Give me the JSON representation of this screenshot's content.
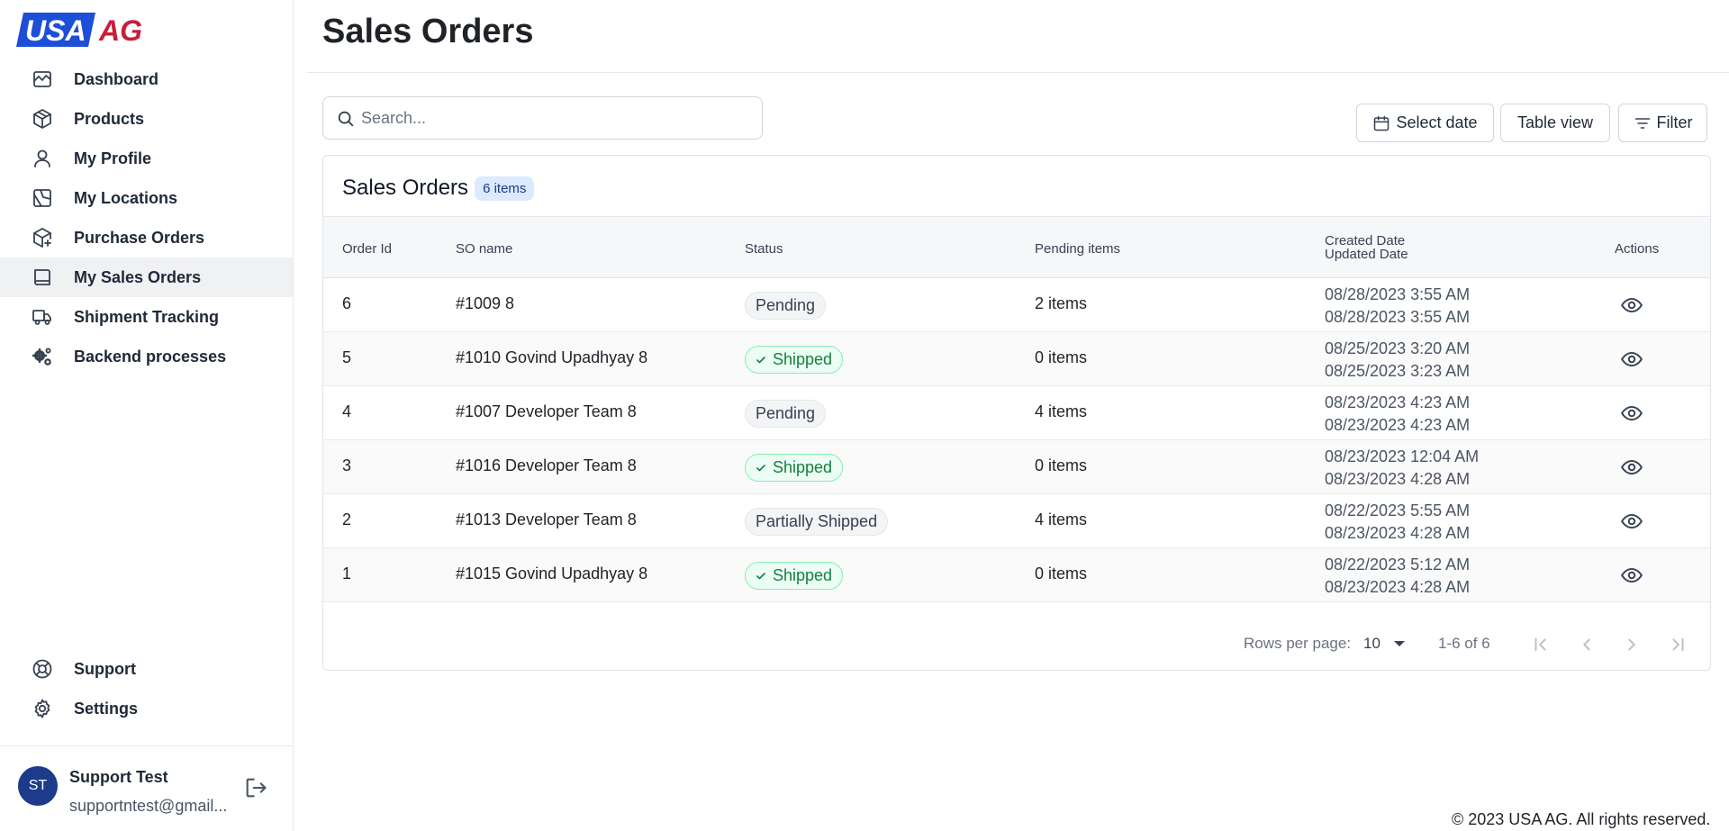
{
  "brand": {
    "logo_text_1": "USA",
    "logo_text_2": "AG",
    "blue": "#1d4ed8",
    "red": "#c81e3a"
  },
  "sidebar": {
    "items": [
      {
        "label": "Dashboard",
        "icon": "chart-icon"
      },
      {
        "label": "Products",
        "icon": "box-icon"
      },
      {
        "label": "My Profile",
        "icon": "user-icon"
      },
      {
        "label": "My Locations",
        "icon": "map-icon"
      },
      {
        "label": "Purchase Orders",
        "icon": "box-plus-icon"
      },
      {
        "label": "My Sales Orders",
        "icon": "book-icon",
        "active": true
      },
      {
        "label": "Shipment Tracking",
        "icon": "truck-icon"
      },
      {
        "label": "Backend processes",
        "icon": "gears-icon"
      }
    ],
    "bottom_items": [
      {
        "label": "Support",
        "icon": "lifebuoy-icon"
      },
      {
        "label": "Settings",
        "icon": "gear-icon"
      }
    ],
    "user": {
      "initials": "ST",
      "name": "Support Test",
      "email": "supportntest@gmail..."
    }
  },
  "header": {
    "title": "Sales Orders"
  },
  "toolbar": {
    "search_placeholder": "Search...",
    "select_date_label": "Select date",
    "table_view_label": "Table view",
    "filter_label": "Filter"
  },
  "table": {
    "title": "Sales Orders",
    "count_badge": "6 items",
    "columns": {
      "order_id": "Order Id",
      "so_name": "SO name",
      "status": "Status",
      "pending": "Pending items",
      "created": "Created Date",
      "updated": "Updated Date",
      "actions": "Actions"
    },
    "rows": [
      {
        "id": "6",
        "name": "#1009 8",
        "status": "Pending",
        "shipped": false,
        "pending": "2 items",
        "created": "08/28/2023 3:55 AM",
        "updated": "08/28/2023 3:55 AM"
      },
      {
        "id": "5",
        "name": "#1010 Govind Upadhyay 8",
        "status": "Shipped",
        "shipped": true,
        "pending": "0 items",
        "created": "08/25/2023 3:20 AM",
        "updated": "08/25/2023 3:23 AM"
      },
      {
        "id": "4",
        "name": "#1007 Developer Team 8",
        "status": "Pending",
        "shipped": false,
        "pending": "4 items",
        "created": "08/23/2023 4:23 AM",
        "updated": "08/23/2023 4:23 AM"
      },
      {
        "id": "3",
        "name": "#1016 Developer Team 8",
        "status": "Shipped",
        "shipped": true,
        "pending": "0 items",
        "created": "08/23/2023 12:04 AM",
        "updated": "08/23/2023 4:28 AM"
      },
      {
        "id": "2",
        "name": "#1013 Developer Team 8",
        "status": "Partially Shipped",
        "shipped": false,
        "pending": "4 items",
        "created": "08/22/2023 5:55 AM",
        "updated": "08/23/2023 4:28 AM"
      },
      {
        "id": "1",
        "name": "#1015 Govind Upadhyay 8",
        "status": "Shipped",
        "shipped": true,
        "pending": "0 items",
        "created": "08/22/2023 5:12 AM",
        "updated": "08/23/2023 4:28 AM"
      }
    ]
  },
  "pagination": {
    "rows_per_page_label": "Rows per page:",
    "rows_per_page": "10",
    "range": "1-6 of 6"
  },
  "footer": {
    "copyright": "© 2023 USA AG. All rights reserved."
  }
}
